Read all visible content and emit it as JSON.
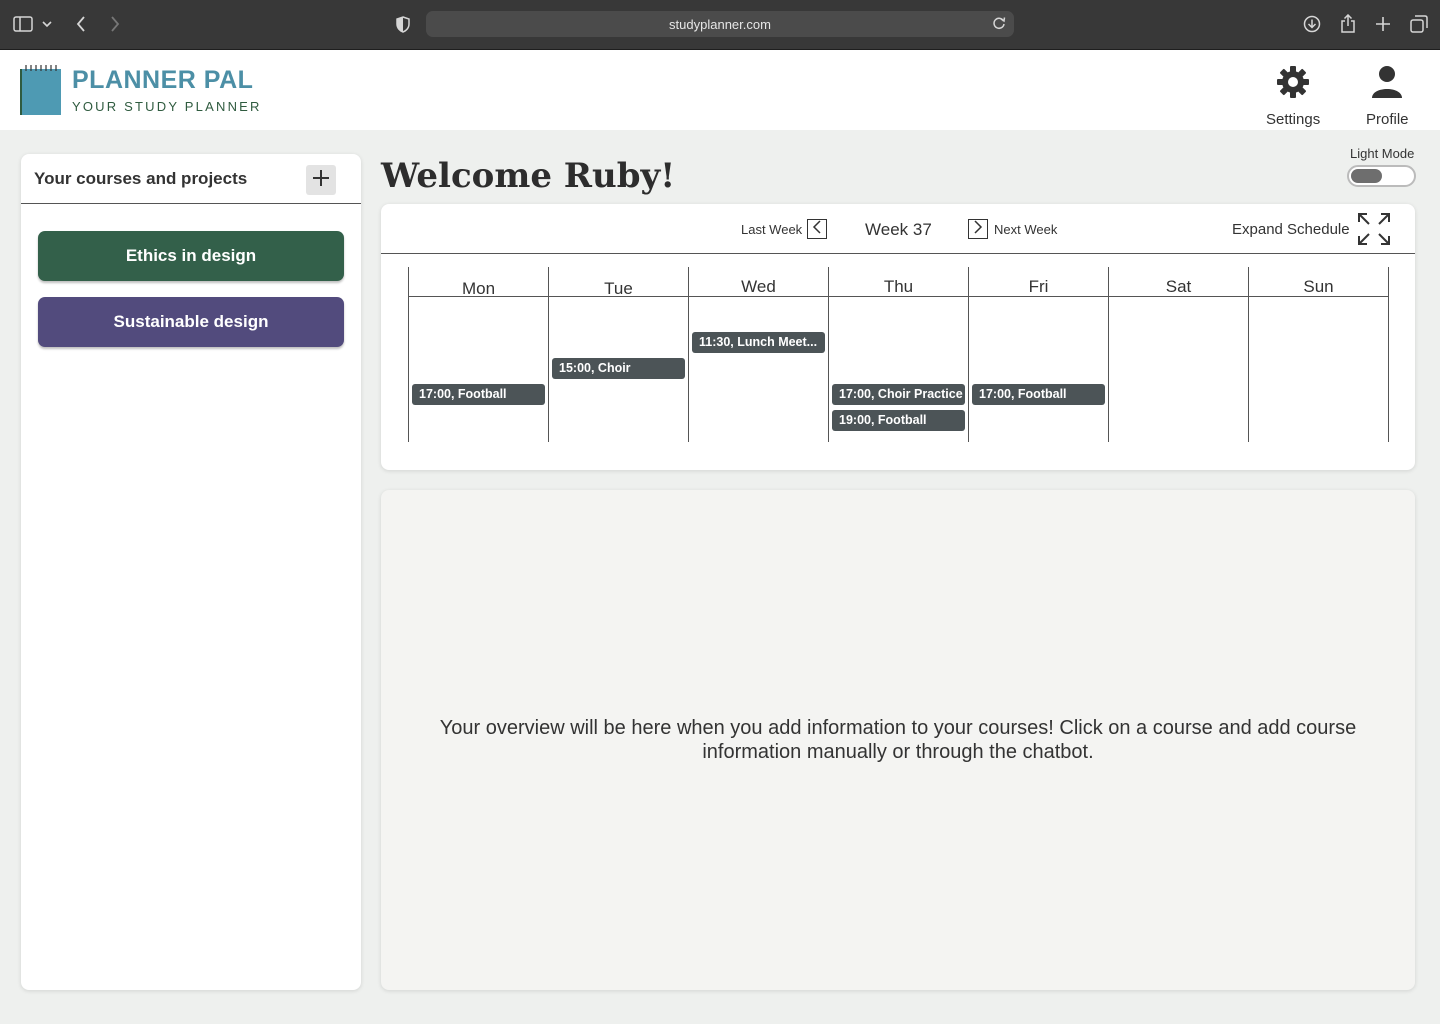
{
  "browser": {
    "url": "studyplanner.com"
  },
  "header": {
    "brand_title": "PLANNER PAL",
    "brand_subtitle": "YOUR STUDY PLANNER",
    "settings_label": "Settings",
    "profile_label": "Profile"
  },
  "sidebar": {
    "title": "Your courses and projects",
    "courses": [
      {
        "label": "Ethics in design",
        "color": "#33604a"
      },
      {
        "label": "Sustainable design",
        "color": "#524b7d"
      }
    ]
  },
  "main": {
    "welcome": "Welcome Ruby!",
    "mode_label": "Light Mode"
  },
  "schedule": {
    "last_week": "Last Week",
    "week": "Week 37",
    "next_week": "Next Week",
    "expand": "Expand Schedule",
    "days": [
      "Mon",
      "Tue",
      "Wed",
      "Thu",
      "Fri",
      "Sat",
      "Sun"
    ],
    "events": {
      "mon": [
        "17:00, Football"
      ],
      "tue": [
        "15:00, Choir"
      ],
      "wed": [
        "11:30, Lunch Meet..."
      ],
      "thu": [
        "17:00, Choir Practice",
        "19:00, Football"
      ],
      "fri": [
        "17:00, Football"
      ]
    }
  },
  "overview": {
    "message": "Your overview will be here when you add information to your courses! Click on a course and add course information manually or through the chatbot."
  },
  "colors": {
    "brand": "#4c8fa6",
    "event": "#4c5457",
    "background": "#eef0ee"
  }
}
